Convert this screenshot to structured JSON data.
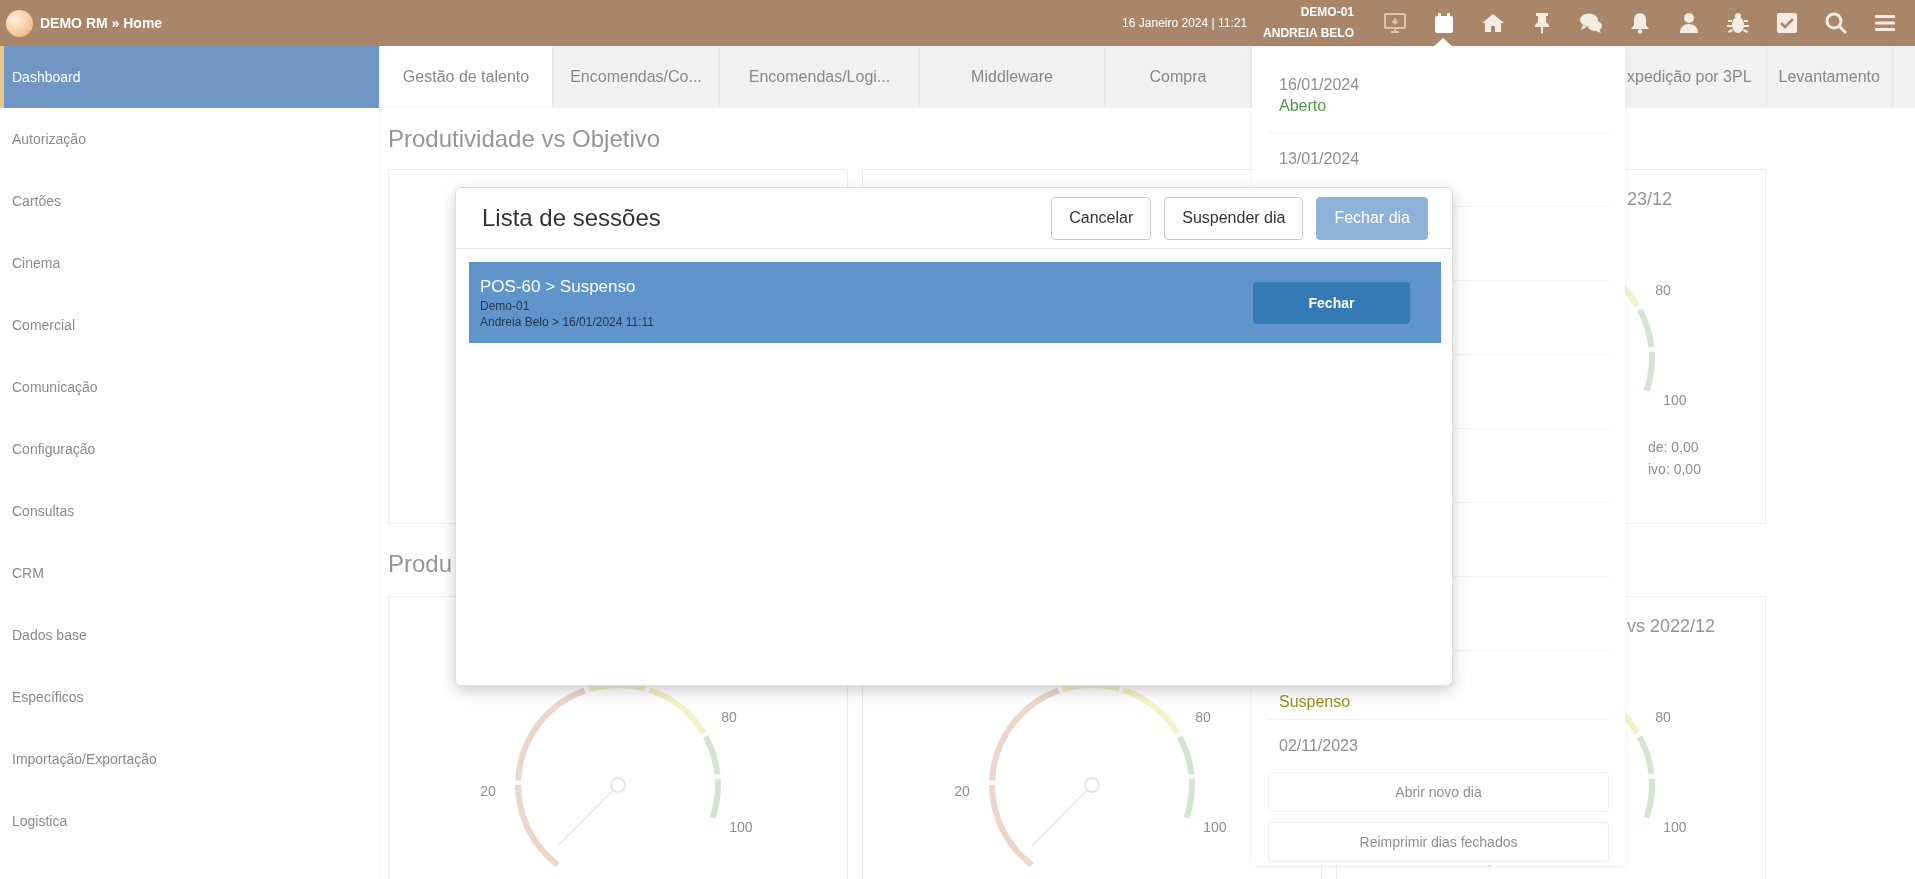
{
  "top_bar": {
    "app_title": "DEMO RM » Home",
    "datetime": "16 Janeiro 2024 | 11:21",
    "terminal": "DEMO-01",
    "user": "ANDREIA BELO",
    "icons": [
      {
        "kind": "monitor",
        "selected": false,
        "disabled": true
      },
      {
        "kind": "calendar",
        "selected": true,
        "disabled": false
      },
      {
        "kind": "home",
        "selected": false,
        "disabled": false
      },
      {
        "kind": "pin",
        "selected": false,
        "disabled": false
      },
      {
        "kind": "chat",
        "selected": false,
        "disabled": false
      },
      {
        "kind": "bell",
        "selected": false,
        "disabled": false
      },
      {
        "kind": "user",
        "selected": false,
        "disabled": false
      },
      {
        "kind": "bug",
        "selected": false,
        "disabled": false
      },
      {
        "kind": "check",
        "selected": false,
        "disabled": false
      },
      {
        "kind": "search",
        "selected": false,
        "disabled": false
      },
      {
        "kind": "menu",
        "selected": false,
        "disabled": false
      }
    ]
  },
  "sidebar": {
    "items": [
      {
        "label": "Dashboard",
        "selected": true
      },
      {
        "label": "Autorização",
        "selected": false
      },
      {
        "label": "Cartões",
        "selected": false
      },
      {
        "label": "Cinema",
        "selected": false
      },
      {
        "label": "Comercial",
        "selected": false
      },
      {
        "label": "Comunicação",
        "selected": false
      },
      {
        "label": "Configuração",
        "selected": false
      },
      {
        "label": "Consultas",
        "selected": false
      },
      {
        "label": "CRM",
        "selected": false
      },
      {
        "label": "Dados base",
        "selected": false
      },
      {
        "label": "Específicos",
        "selected": false
      },
      {
        "label": "Importação/Exportação",
        "selected": false
      },
      {
        "label": "Logistica",
        "selected": false
      }
    ]
  },
  "tabs": [
    {
      "label": "Gestão de talento",
      "selected": true
    },
    {
      "label": "Encomendas/Co...",
      "selected": false
    },
    {
      "label": "Encomendas/Logi...",
      "selected": false
    },
    {
      "label": "Middleware",
      "selected": false
    },
    {
      "label": "Compra",
      "selected": false
    },
    {
      "label": "xpedição por 3PL",
      "selected": false
    },
    {
      "label": "Levantamento",
      "selected": false
    }
  ],
  "sections": [
    {
      "title": "Produtividade vs Objetivo",
      "cards": [
        {
          "kind": "gauge"
        },
        {
          "kind": "gauge"
        },
        {
          "kind": "gauge",
          "title": "23/12",
          "gauge": {
            "ticks": [
              "80",
              "100"
            ]
          },
          "stats": [
            "de: 0,00",
            "ivo: 0,00"
          ]
        }
      ]
    },
    {
      "title": "Produ",
      "cards": [
        {
          "kind": "gauge",
          "gauge": {
            "ticks": [
              "20",
              "80",
              "100"
            ]
          }
        },
        {
          "kind": "gauge",
          "gauge": {
            "ticks": [
              "20",
              "80",
              "100"
            ]
          }
        },
        {
          "kind": "gauge",
          "title": "vs 2022/12",
          "gauge": {
            "ticks": [
              "80",
              "100"
            ]
          }
        }
      ]
    }
  ],
  "days_panel": {
    "entries_top": [
      {
        "date": "16/01/2024",
        "status": "Aberto",
        "kind": "open"
      },
      {
        "date": "13/01/2024"
      }
    ],
    "entries_bottom": [
      {
        "status": "Suspenso",
        "kind": "suspended"
      },
      {
        "date": "02/11/2023"
      }
    ],
    "buttons": [
      "Abrir novo dia",
      "Reimprimir dias fechados"
    ]
  },
  "modal": {
    "title": "Lista de sessões",
    "buttons": [
      {
        "label": "Cancelar",
        "kind": "default",
        "disabled": false
      },
      {
        "label": "Suspender dia",
        "kind": "default",
        "disabled": false
      },
      {
        "label": "Fechar dia",
        "kind": "primary",
        "disabled": true
      }
    ],
    "sessions": [
      {
        "title": "POS-60 > Suspenso",
        "terminal": "Demo-01",
        "detail": "Andreia Belo > 16/01/2024 11:11",
        "action": "Fechar",
        "selected": true
      }
    ]
  }
}
